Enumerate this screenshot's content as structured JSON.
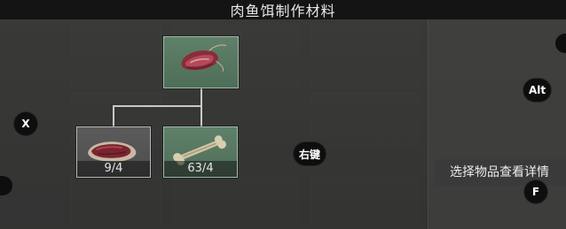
{
  "header": {
    "title": "肉鱼饵制作材料"
  },
  "recipe": {
    "result": {
      "name": "meat-bait-icon",
      "rarity_color": "#5f8069"
    },
    "materials": [
      {
        "icon": "raw-meat-icon",
        "count": "9/4",
        "sufficient": true,
        "frame_color": "#5c5c5c"
      },
      {
        "icon": "bone-icon",
        "count": "63/4",
        "sufficient": true,
        "frame_color": "#5f8069"
      }
    ]
  },
  "key_hints": {
    "close_key": "X",
    "alt_key": "Alt",
    "right_click_key": "右键",
    "details_key": "F"
  },
  "details_panel": {
    "hint": "选择物品查看详情"
  },
  "colors": {
    "slot_green": "#5f8069",
    "slot_gray": "#5c5c5c",
    "connector": "#c8c8c8",
    "top_bar": "#141414"
  }
}
